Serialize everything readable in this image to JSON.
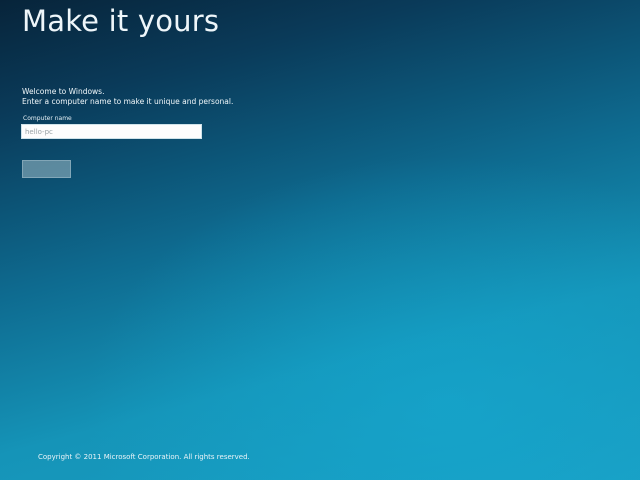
{
  "page": {
    "title": "Make it yours"
  },
  "intro": {
    "line1": "Welcome to Windows.",
    "line2": "Enter a computer name to make it unique and personal."
  },
  "computer_name": {
    "label": "Computer name",
    "value": "",
    "placeholder": "hello-pc"
  },
  "next_button": {
    "label": ""
  },
  "footer": {
    "copyright": "Copyright © 2011 Microsoft Corporation.  All rights reserved."
  },
  "colors": {
    "background_top": "#07243a",
    "background_bottom": "#1a9fc4",
    "input_background": "#fdfdfd",
    "button_disabled": "#a0bec8"
  }
}
